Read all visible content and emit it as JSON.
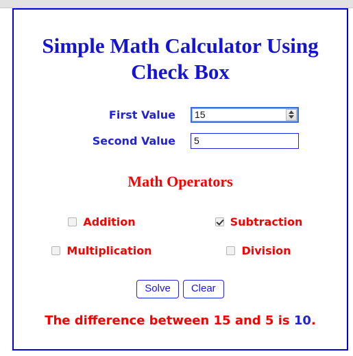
{
  "page": {
    "title": "Simple Math Calculator Using Check Box",
    "frame_border_color": "#0000dd"
  },
  "colors": {
    "title_blue": "#1414d2",
    "label_blue": "#2222dd",
    "operator_red": "#fa0000",
    "result_red": "#fa0000",
    "result_number_blue": "#2222dd",
    "button_blue": "#1414ee"
  },
  "fields": [
    {
      "label": "First Value",
      "value": "15",
      "placeholder": "",
      "type": "number",
      "has_spinner": true,
      "focused": true
    },
    {
      "label": "Second Value",
      "value": "5",
      "placeholder": "",
      "type": "text",
      "has_spinner": false,
      "focused": false
    }
  ],
  "operators": {
    "heading": "Math Operators",
    "items": [
      {
        "label": "Addition",
        "checked": false
      },
      {
        "label": "Subtraction",
        "checked": true
      },
      {
        "label": "Multiplication",
        "checked": false
      },
      {
        "label": "Division",
        "checked": false
      }
    ]
  },
  "buttons": {
    "solve_label": "Solve",
    "clear_label": "Clear"
  },
  "result": {
    "prefix": "The difference between 15 and 5 is ",
    "number": "10",
    "suffix": "."
  }
}
